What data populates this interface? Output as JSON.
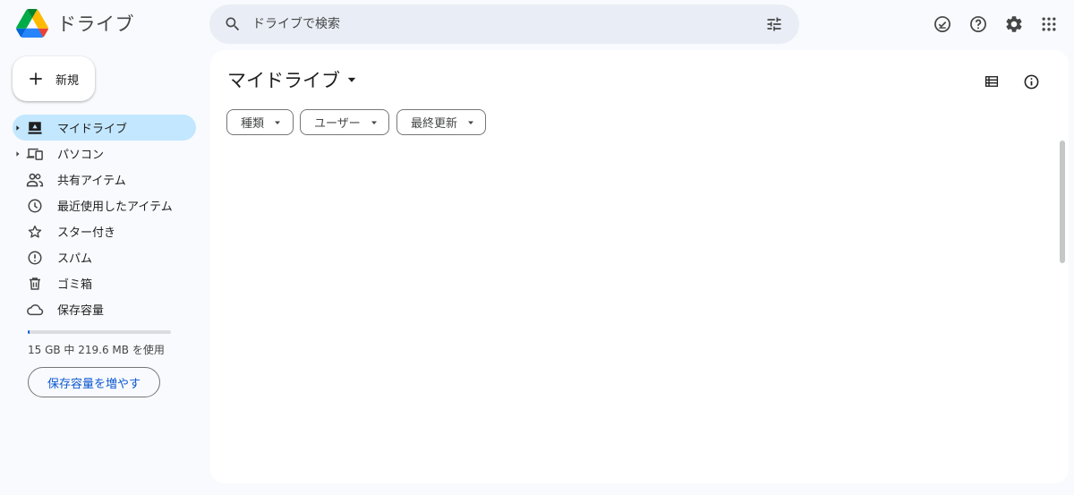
{
  "app": {
    "name": "ドライブ"
  },
  "search": {
    "placeholder": "ドライブで検索"
  },
  "header_icons": [
    "offline-status-icon",
    "help-icon",
    "settings-icon",
    "apps-grid-icon"
  ],
  "new_button": {
    "label": "新規"
  },
  "sidebar": {
    "items": [
      {
        "label": "マイドライブ",
        "icon": "my-drive-icon",
        "active": true,
        "expandable": true
      },
      {
        "label": "パソコン",
        "icon": "computers-icon",
        "active": false,
        "expandable": true
      },
      {
        "label": "共有アイテム",
        "icon": "shared-icon",
        "active": false,
        "expandable": false
      },
      {
        "label": "最近使用したアイテム",
        "icon": "clock-icon",
        "active": false,
        "expandable": false
      },
      {
        "label": "スター付き",
        "icon": "star-icon",
        "active": false,
        "expandable": false
      },
      {
        "label": "スパム",
        "icon": "spam-icon",
        "active": false,
        "expandable": false
      },
      {
        "label": "ゴミ箱",
        "icon": "trash-icon",
        "active": false,
        "expandable": false
      },
      {
        "label": "保存容量",
        "icon": "cloud-icon",
        "active": false,
        "expandable": false
      }
    ]
  },
  "storage": {
    "used_fraction": 0.0143,
    "text": "15 GB 中 219.6 MB を使用",
    "button_label": "保存容量を増やす"
  },
  "main": {
    "title": "マイドライブ",
    "filters": [
      {
        "label": "種類"
      },
      {
        "label": "ユーザー"
      },
      {
        "label": "最終更新"
      }
    ]
  },
  "colors": {
    "active_nav": "#c2e7ff",
    "search_bg": "#e9eef6",
    "accent": "#0b57d0",
    "page_bg": "#f8fafd"
  }
}
